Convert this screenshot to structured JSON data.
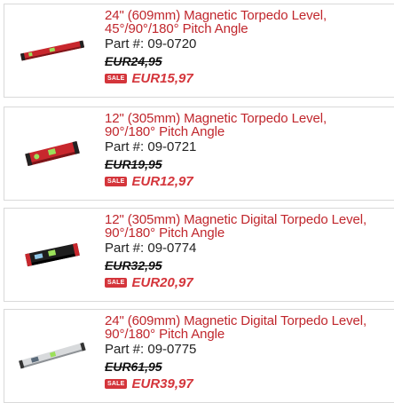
{
  "products": [
    {
      "title_line1": "24\" (609mm) Magnetic Torpedo Level,",
      "title_line2": "45°/90°/180° Pitch Angle",
      "part": "Part #: 09-0720",
      "old_price": "EUR24,95",
      "sale_badge": "SALE",
      "new_price": "EUR15,97",
      "image_icon": "red-torpedo-level-icon"
    },
    {
      "title_line1": "12\" (305mm) Magnetic Torpedo Level,",
      "title_line2": "90°/180° Pitch Angle",
      "part": "Part #: 09-0721",
      "old_price": "EUR19,95",
      "sale_badge": "SALE",
      "new_price": "EUR12,97",
      "image_icon": "red-torpedo-level-icon"
    },
    {
      "title_line1": "12\" (305mm) Magnetic Digital Torpedo Level,",
      "title_line2": "90°/180° Pitch Angle",
      "part": "Part #: 09-0774",
      "old_price": "EUR32,95",
      "sale_badge": "SALE",
      "new_price": "EUR20,97",
      "image_icon": "black-digital-level-icon"
    },
    {
      "title_line1": "24\" (609mm) Magnetic Digital Torpedo Level,",
      "title_line2": "90°/180° Pitch Angle",
      "part": "Part #: 09-0775",
      "old_price": "EUR61,95",
      "sale_badge": "SALE",
      "new_price": "EUR39,97",
      "image_icon": "silver-digital-level-icon"
    }
  ],
  "colors": {
    "title": "#c0262c",
    "sale": "#d4353b",
    "border": "#d9d9d9"
  }
}
